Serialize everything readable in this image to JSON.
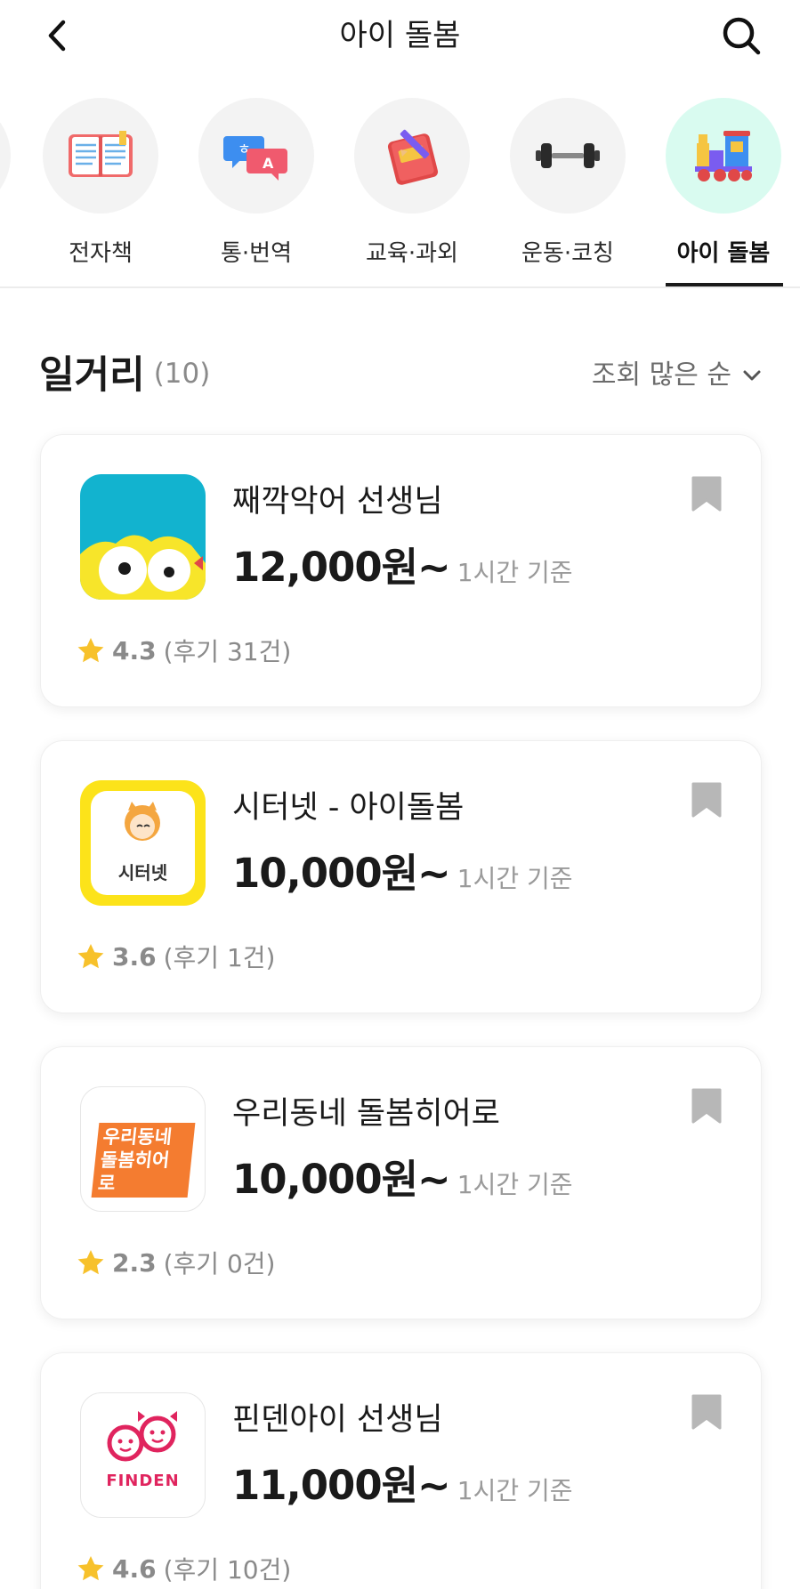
{
  "header": {
    "title": "아이 돌봄"
  },
  "categories": [
    {
      "label": "전자책",
      "icon": "book-icon"
    },
    {
      "label": "통·번역",
      "icon": "translate-icon"
    },
    {
      "label": "교육·과외",
      "icon": "education-icon"
    },
    {
      "label": "운동·코칭",
      "icon": "dumbbell-icon"
    },
    {
      "label": "아이 돌봄",
      "icon": "toy-train-icon",
      "active": true
    }
  ],
  "section": {
    "title": "일거리",
    "count": "(10)",
    "sort_label": "조회 많은 순"
  },
  "listings": [
    {
      "name": "째깍악어 선생님",
      "price": "12,000원~",
      "unit": "1시간 기준",
      "rating": "4.3",
      "reviews": "(후기 31건)"
    },
    {
      "name": "시터넷 - 아이돌봄",
      "price": "10,000원~",
      "unit": "1시간 기준",
      "rating": "3.6",
      "reviews": "(후기 1건)",
      "logo_text": "시터넷"
    },
    {
      "name": "우리동네 돌봄히어로",
      "price": "10,000원~",
      "unit": "1시간 기준",
      "rating": "2.3",
      "reviews": "(후기 0건)",
      "logo_text": "우리동네 돌봄히어로"
    },
    {
      "name": "핀덴아이 선생님",
      "price": "11,000원~",
      "unit": "1시간 기준",
      "rating": "4.6",
      "reviews": "(후기 10건)",
      "logo_text": "FINDEN"
    }
  ],
  "colors": {
    "active_category_bg": "#d9fbf0",
    "star": "#f7c12b",
    "bookmark": "#b7b7b7"
  }
}
